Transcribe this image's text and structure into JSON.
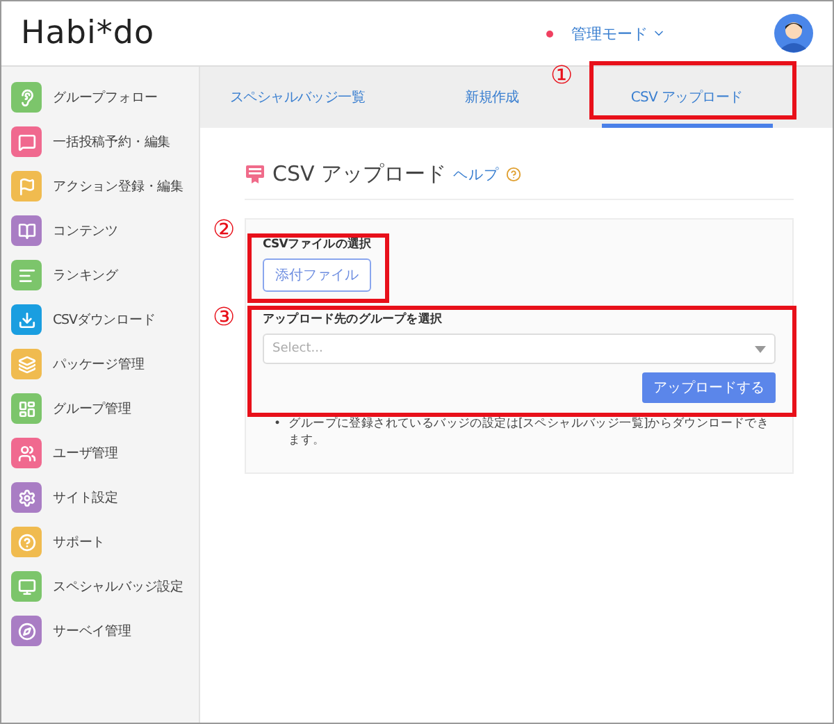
{
  "header": {
    "logo": "Habi*do",
    "mode_menu": "管理モード"
  },
  "sidebar": {
    "items": [
      {
        "label": "グループフォロー",
        "color": "#7cc56b"
      },
      {
        "label": "一括投稿予約・編集",
        "color": "#f0698f"
      },
      {
        "label": "アクション登録・編集",
        "color": "#f0bb4f"
      },
      {
        "label": "コンテンツ",
        "color": "#a97dc4"
      },
      {
        "label": "ランキング",
        "color": "#7cc56b"
      },
      {
        "label": "CSVダウンロード",
        "color": "#1a9ee0"
      },
      {
        "label": "パッケージ管理",
        "color": "#f0bb4f"
      },
      {
        "label": "グループ管理",
        "color": "#7cc56b"
      },
      {
        "label": "ユーザ管理",
        "color": "#f0698f"
      },
      {
        "label": "サイト設定",
        "color": "#a97dc4"
      },
      {
        "label": "サポート",
        "color": "#f0bb4f"
      },
      {
        "label": "スペシャルバッジ設定",
        "color": "#7cc56b"
      },
      {
        "label": "サーベイ管理",
        "color": "#a97dc4"
      }
    ]
  },
  "tabs": [
    {
      "label": "スペシャルバッジ一覧",
      "selected": false
    },
    {
      "label": "新規作成",
      "selected": false
    },
    {
      "label": "CSV アップロード",
      "selected": true
    }
  ],
  "page": {
    "title": "CSV アップロード",
    "help_link": "ヘルプ",
    "file_section": {
      "label": "CSVファイルの選択",
      "button": "添付ファイル"
    },
    "group_section": {
      "label": "アップロード先のグループを選択",
      "select": {
        "placeholder": "Select..."
      },
      "button": "アップロードする"
    },
    "notes": [
      {
        "bullet": "•",
        "text": "グループに登録されているバッジの設定は[スペシャルバッジ一覧]からダウンロードできます。"
      }
    ]
  },
  "annotations": [
    "①",
    "②",
    "③"
  ]
}
